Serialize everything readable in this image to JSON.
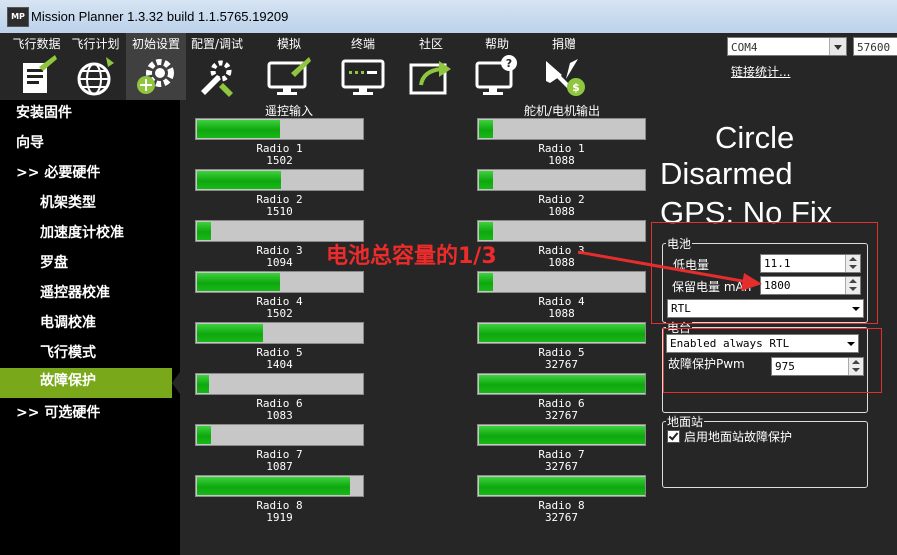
{
  "window": {
    "icon_text": "MP",
    "title": "Mission Planner 1.3.32 build 1.1.5765.19209"
  },
  "toolbar": {
    "items": [
      {
        "label": "飞行数据",
        "icon": "flight-data-icon"
      },
      {
        "label": "飞行计划",
        "icon": "flight-plan-globe-icon"
      },
      {
        "label": "初始设置",
        "icon": "initial-setup-gear-icon"
      },
      {
        "label": "配置/调试",
        "icon": "config-tuning-wrench-icon"
      },
      {
        "label": "模拟",
        "icon": "simulation-monitor-icon"
      },
      {
        "label": "终端",
        "icon": "terminal-icon"
      },
      {
        "label": "社区",
        "icon": "community-share-icon"
      },
      {
        "label": "帮助",
        "icon": "help-monitor-icon"
      },
      {
        "label": "捐赠",
        "icon": "donate-plane-icon"
      }
    ],
    "port": "COM4",
    "baud": "57600",
    "link_stats": "链接统计..."
  },
  "sidebar": {
    "items": [
      {
        "label": "安装固件"
      },
      {
        "label": "向导"
      },
      {
        "label": ">> 必要硬件"
      },
      {
        "label": "机架类型"
      },
      {
        "label": "加速度计校准"
      },
      {
        "label": "罗盘"
      },
      {
        "label": "遥控器校准"
      },
      {
        "label": "电调校准"
      },
      {
        "label": "飞行模式"
      },
      {
        "label": "故障保护"
      },
      {
        "label": ">> 可选硬件"
      }
    ],
    "active_index": 9
  },
  "radio_in": {
    "title": "遥控输入",
    "channels": [
      {
        "name": "Radio 1",
        "value": "1502",
        "fill": 0.5
      },
      {
        "name": "Radio 2",
        "value": "1510",
        "fill": 0.51
      },
      {
        "name": "Radio 3",
        "value": "1094",
        "fill": 0.09
      },
      {
        "name": "Radio 4",
        "value": "1502",
        "fill": 0.5
      },
      {
        "name": "Radio 5",
        "value": "1404",
        "fill": 0.4
      },
      {
        "name": "Radio 6",
        "value": "1083",
        "fill": 0.08
      },
      {
        "name": "Radio 7",
        "value": "1087",
        "fill": 0.09
      },
      {
        "name": "Radio 8",
        "value": "1919",
        "fill": 0.92
      }
    ]
  },
  "servo_out": {
    "title": "舵机/电机输出",
    "channels": [
      {
        "name": "Radio 1",
        "value": "1088",
        "fill": 0.09
      },
      {
        "name": "Radio 2",
        "value": "1088",
        "fill": 0.09
      },
      {
        "name": "Radio 3",
        "value": "1088",
        "fill": 0.09
      },
      {
        "name": "Radio 4",
        "value": "1088",
        "fill": 0.09
      },
      {
        "name": "Radio 5",
        "value": "32767",
        "fill": 1.0
      },
      {
        "name": "Radio 6",
        "value": "32767",
        "fill": 1.0
      },
      {
        "name": "Radio 7",
        "value": "32767",
        "fill": 1.0
      },
      {
        "name": "Radio 8",
        "value": "32767",
        "fill": 1.0
      }
    ]
  },
  "status": {
    "mode": "Circle",
    "armed": "Disarmed",
    "gps": "GPS: No Fix"
  },
  "battery": {
    "title": "电池",
    "low_voltage_label": "低电量",
    "low_voltage": "11.1",
    "reserved_label": "保留电量 mAh",
    "reserved": "1800",
    "action": "RTL"
  },
  "radio_fs": {
    "title": "电台",
    "action": "Enabled always RTL",
    "pwm_label": "故障保护Pwm",
    "pwm": "975"
  },
  "gcs_fs": {
    "title": "地面站",
    "checkbox_label": "启用地面站故障保护",
    "checked": true
  },
  "annotation": {
    "text": "电池总容量的1/3",
    "color": "#ee2b2b"
  },
  "colors": {
    "bar_fill": "#10b010",
    "active_sidebar": "#79a91a",
    "background": "#262626"
  }
}
